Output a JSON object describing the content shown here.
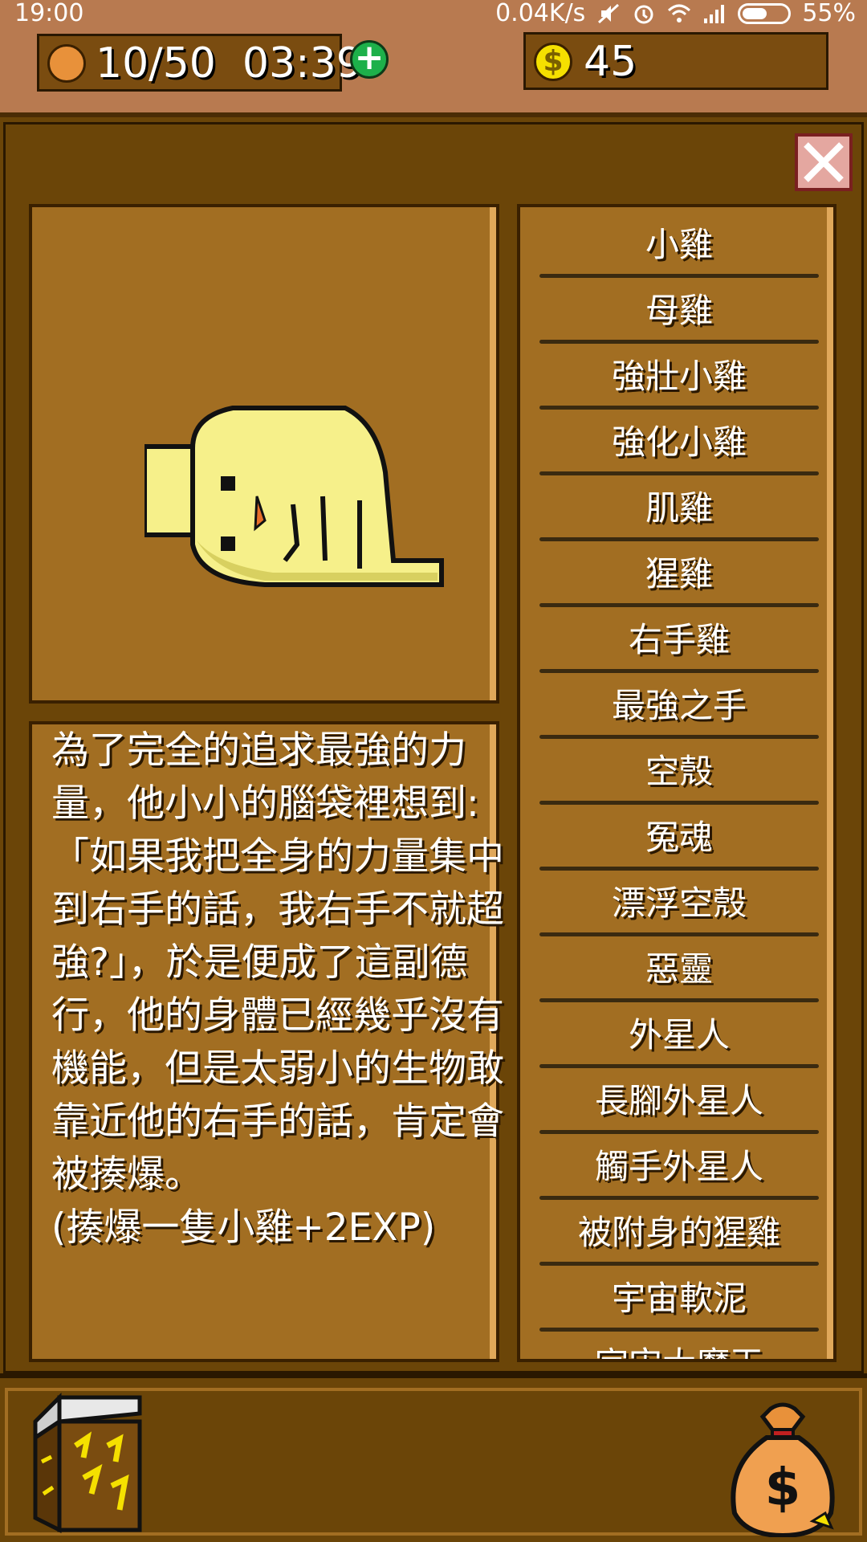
{
  "status_bar": {
    "time": "19:00",
    "network_speed": "0.04K/s",
    "battery": "55%",
    "battery_level": 0.55,
    "icons": [
      "mute-icon",
      "alarm-icon",
      "wifi-icon",
      "signal-icon",
      "battery-icon"
    ]
  },
  "header": {
    "energy": "10/50",
    "timer": "03:39",
    "gold": "45",
    "plus_symbol": "+",
    "coin_symbol": "$"
  },
  "detail": {
    "description": "為了完全的追求最強的力量，他小小的腦袋裡想到:「如果我把全身的力量集中到右手的話，我右手不就超強?」，於是便成了這副德行，他的身體已經幾乎沒有機能，但是太弱小的生物敢靠近他的右手的話，肯定會被揍爆。\n(揍爆一隻小雞+2EXP)"
  },
  "creature_list": [
    {
      "label": "小雞"
    },
    {
      "label": "母雞"
    },
    {
      "label": "強壯小雞"
    },
    {
      "label": "強化小雞"
    },
    {
      "label": "肌雞"
    },
    {
      "label": "猩雞"
    },
    {
      "label": "右手雞"
    },
    {
      "label": "最強之手"
    },
    {
      "label": "空殼"
    },
    {
      "label": "冤魂"
    },
    {
      "label": "漂浮空殼"
    },
    {
      "label": "惡靈"
    },
    {
      "label": "外星人"
    },
    {
      "label": "長腳外星人"
    },
    {
      "label": "觸手外星人"
    },
    {
      "label": "被附身的猩雞"
    },
    {
      "label": "宇宙軟泥"
    },
    {
      "label": "宇宙大魔王"
    }
  ],
  "colors": {
    "panel_brown": "#a26e22",
    "dark_brown": "#6b4508",
    "header_tan": "#b87a50",
    "plus_green": "#1db04a",
    "coin_yellow": "#f5e000"
  }
}
